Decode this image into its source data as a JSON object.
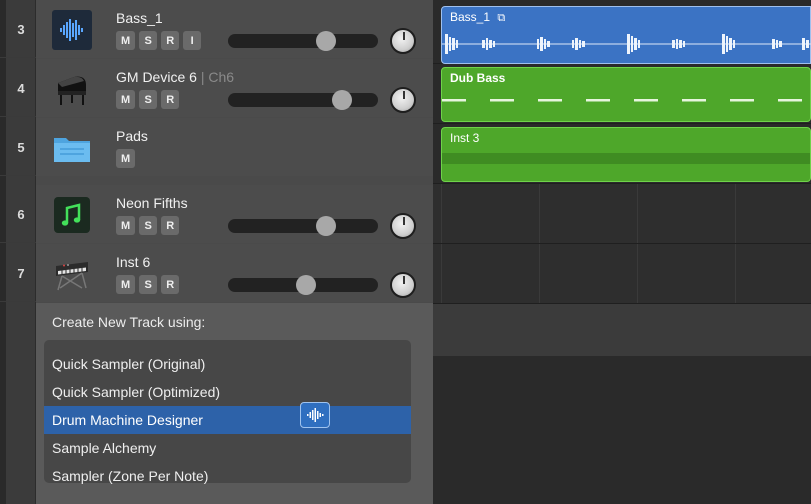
{
  "tracks": [
    {
      "number": "3",
      "name": "Bass_1",
      "channel": "",
      "buttons": [
        "M",
        "S",
        "R",
        "I"
      ],
      "fader_level": 0.68,
      "icon": "waveform-icon",
      "has_fader": true
    },
    {
      "number": "4",
      "name": "GM Device 6",
      "channel": "| Ch6",
      "buttons": [
        "M",
        "S",
        "R"
      ],
      "fader_level": 0.8,
      "icon": "grand-piano-icon",
      "has_fader": true
    },
    {
      "number": "5",
      "name": "Pads",
      "channel": "",
      "buttons": [
        "M"
      ],
      "fader_level": null,
      "icon": "folder-icon",
      "has_fader": false
    },
    {
      "number": "6",
      "name": "Neon Fifths",
      "channel": "",
      "buttons": [
        "M",
        "S",
        "R"
      ],
      "fader_level": 0.68,
      "icon": "music-note-icon",
      "has_fader": true
    },
    {
      "number": "7",
      "name": "Inst 6",
      "channel": "",
      "buttons": [
        "M",
        "S",
        "R"
      ],
      "fader_level": 0.52,
      "icon": "synthesizer-keyboard-icon",
      "has_fader": true
    }
  ],
  "regions": [
    {
      "title": "Bass_1",
      "color": "#3b73c4",
      "type": "audio",
      "extra_icon": "loop-icon"
    },
    {
      "title": "Dub Bass",
      "color": "#4ea72a",
      "type": "midi"
    },
    {
      "title": "Inst 3",
      "color": "#4ea72a",
      "type": "folder"
    }
  ],
  "create_track": {
    "title": "Create New Track using:",
    "options": [
      "Quick Sampler (Original)",
      "Quick Sampler (Optimized)",
      "Drum Machine Designer",
      "Sample Alchemy",
      "Sampler (Zone Per Note)"
    ],
    "selected_index": 2
  },
  "colors": {
    "accent": "#2d62a9",
    "audio_region": "#3b73c4",
    "midi_region": "#4ea72a"
  }
}
